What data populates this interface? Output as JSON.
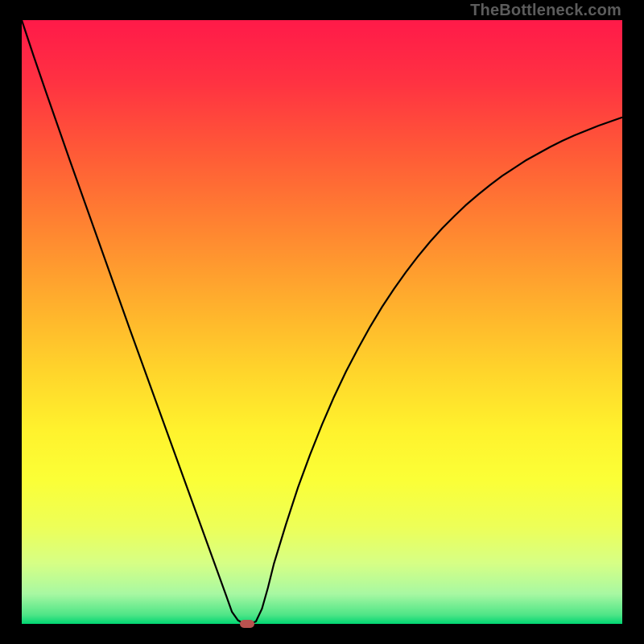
{
  "watermark": "TheBottleneck.com",
  "chart_data": {
    "type": "line",
    "title": "",
    "xlabel": "",
    "ylabel": "",
    "xlim": [
      0,
      100
    ],
    "ylim": [
      0,
      100
    ],
    "grid": false,
    "legend": false,
    "color_scale_note": "vertical gradient red (top) to green (bottom) indicating bottleneck severity",
    "series": [
      {
        "name": "bottleneck",
        "x": [
          0,
          2,
          4,
          6,
          8,
          10,
          12,
          14,
          16,
          18,
          20,
          22,
          24,
          26,
          28,
          30,
          32,
          34,
          35,
          36,
          37,
          38,
          39,
          40,
          41,
          42,
          44,
          46,
          48,
          50,
          52,
          54,
          56,
          58,
          60,
          62,
          64,
          66,
          68,
          70,
          72,
          74,
          76,
          78,
          80,
          82,
          84,
          86,
          88,
          90,
          92,
          94,
          96,
          98,
          100
        ],
        "y": [
          100,
          94,
          88.2,
          82.5,
          76.8,
          71.2,
          65.6,
          60,
          54.4,
          48.8,
          43.3,
          37.8,
          32.3,
          26.8,
          21.3,
          15.8,
          10.3,
          4.8,
          2,
          0.6,
          0,
          0,
          0.4,
          2.5,
          6,
          10,
          16.5,
          22.6,
          28,
          33,
          37.6,
          41.8,
          45.6,
          49.2,
          52.5,
          55.5,
          58.3,
          60.9,
          63.3,
          65.5,
          67.5,
          69.4,
          71.1,
          72.7,
          74.2,
          75.5,
          76.8,
          77.9,
          79,
          80,
          80.9,
          81.7,
          82.5,
          83.2,
          83.9
        ]
      }
    ],
    "min_point": {
      "x": 37.5,
      "y": 0
    },
    "gradient_stops": [
      {
        "offset": 0.0,
        "color": "#ff1a49"
      },
      {
        "offset": 0.1,
        "color": "#ff3142"
      },
      {
        "offset": 0.22,
        "color": "#ff5a37"
      },
      {
        "offset": 0.34,
        "color": "#ff8331"
      },
      {
        "offset": 0.46,
        "color": "#ffac2d"
      },
      {
        "offset": 0.58,
        "color": "#ffd42b"
      },
      {
        "offset": 0.68,
        "color": "#fff22d"
      },
      {
        "offset": 0.76,
        "color": "#fbff36"
      },
      {
        "offset": 0.84,
        "color": "#edff58"
      },
      {
        "offset": 0.9,
        "color": "#d6ff85"
      },
      {
        "offset": 0.95,
        "color": "#a8f8a2"
      },
      {
        "offset": 0.985,
        "color": "#4fe587"
      },
      {
        "offset": 1.0,
        "color": "#00d672"
      }
    ]
  },
  "colors": {
    "curve_stroke": "#000000",
    "marker_fill": "#b9524f",
    "frame_background": "#000000",
    "watermark_text": "#5c5c5c"
  }
}
